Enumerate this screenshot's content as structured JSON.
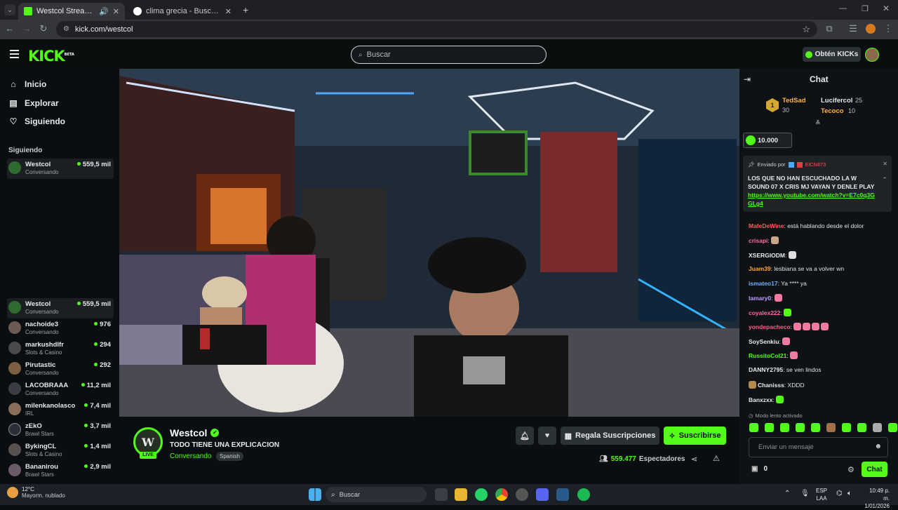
{
  "browser": {
    "tabs": [
      {
        "title": "Westcol Stream - Watch Live"
      },
      {
        "title": "clima grecia - Buscar con Google"
      }
    ],
    "url": "kick.com/westcol"
  },
  "header": {
    "logo": "KICK",
    "logo_badge": "BETA",
    "search_placeholder": "Buscar",
    "get_kicks": "Obtén KICKs"
  },
  "sidebar": {
    "nav": [
      {
        "label": "Inicio",
        "icon": "home-icon"
      },
      {
        "label": "Explorar",
        "icon": "compass-icon"
      },
      {
        "label": "Siguiendo",
        "icon": "heart-icon"
      }
    ],
    "following_heading": "Siguiendo",
    "following": [
      {
        "name": "Westcol",
        "category": "Conversando",
        "viewers": "559,5 mil"
      }
    ],
    "recommended": [
      {
        "name": "Westcol",
        "category": "Conversando",
        "viewers": "559,5 mil"
      },
      {
        "name": "nachoide3",
        "category": "Conversando",
        "viewers": "976"
      },
      {
        "name": "markushdlfr",
        "category": "Slots & Casino",
        "viewers": "294"
      },
      {
        "name": "Pirutastic",
        "category": "Conversando",
        "viewers": "292"
      },
      {
        "name": "LACOBRAAA",
        "category": "Conversando",
        "viewers": "11,2 mil"
      },
      {
        "name": "milenkanolasco",
        "category": "IRL",
        "viewers": "7,4 mil"
      },
      {
        "name": "zEkO",
        "category": "Brawl Stars",
        "viewers": "3,7 mil"
      },
      {
        "name": "BykingCL",
        "category": "Slots & Casino",
        "viewers": "1,4 mil"
      },
      {
        "name": "Bananirou",
        "category": "Brawl Stars",
        "viewers": "2,9 mil"
      }
    ]
  },
  "stream": {
    "channel": "Westcol",
    "live_badge": "LIVE",
    "title": "TODO TIENE UNA EXPLICACION",
    "category": "Conversando",
    "language": "Spanish",
    "gift_subs": "Regala Suscripciones",
    "subscribe": "Suscribirse",
    "viewers": "559.477",
    "viewers_label": "Espectadores"
  },
  "chat": {
    "title": "Chat",
    "leaderboard": [
      {
        "rank": "1",
        "name": "TedSad",
        "value": "30"
      },
      {
        "name": "Lucifercol",
        "value": "25"
      },
      {
        "name": "Tecoco",
        "value": "10"
      }
    ],
    "pinned_kicks": "10.000",
    "pinned_by_label": "Enviado por",
    "pinned_by_user": "ElChill73",
    "pinned_message": "LOS QUE NO HAN ESCUCHADO LA W SOUND 07 X CRIS MJ VAYAN Y DENLE PLAY",
    "pinned_link": "https://www.youtube.com/watch?v=E7c0q3GGLg4",
    "messages": [
      {
        "user": "MafeDeWine",
        "text": ": está hablando desde el dolor",
        "color": "#ff5b5b"
      },
      {
        "user": "crisapi",
        "text": ":",
        "color": "#ff6b9d"
      },
      {
        "user": "XSERGIODM",
        "text": ":",
        "color": "#e7e9ea"
      },
      {
        "user": "Juam39",
        "text": ": lesbiana se va a volver wn",
        "color": "#ffa238"
      },
      {
        "user": "ismateo17",
        "text": ": Ya **** ya",
        "color": "#6ab0ff"
      },
      {
        "user": "lamary0",
        "text": ":",
        "color": "#c39bff"
      },
      {
        "user": "coyalex222",
        "text": ":",
        "color": "#ff6b9d"
      },
      {
        "user": "yondepacheco",
        "text": ":",
        "color": "#ff5b8a"
      },
      {
        "user": "SoySenkiu",
        "text": ":",
        "color": "#e7e9ea"
      },
      {
        "user": "RussitoCol21",
        "text": ":",
        "color": "#53fc18"
      },
      {
        "user": "DANNY2795",
        "text": ": se ven lindos",
        "color": "#e7e9ea"
      },
      {
        "user": "Chanisss",
        "text": ": XDDD",
        "color": "#e7e9ea"
      },
      {
        "user": "Banxzxx",
        "text": ":",
        "color": "#e7e9ea"
      }
    ],
    "slow_mode": "Modo lento activado",
    "input_placeholder": "Enviar un mensaje",
    "points": "0",
    "send": "Chat"
  },
  "taskbar": {
    "weather_temp": "12°C",
    "weather_desc": "Mayorm. nublado",
    "search": "Buscar",
    "lang": "ESP",
    "lang2": "LAA",
    "time": "10:49 p. m.",
    "date": "1/01/2026"
  }
}
